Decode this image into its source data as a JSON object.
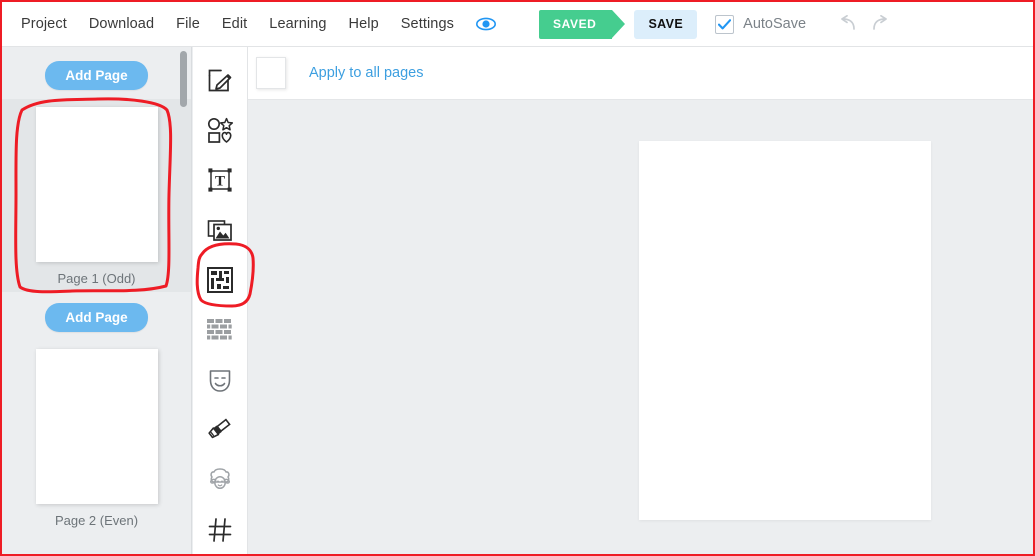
{
  "app": {
    "accent_blue": "#3d9fe0",
    "accent_green": "#45cd8f",
    "annotation_color": "#ee1c25",
    "button_blue": "#6cb9ef"
  },
  "topbar": {
    "menu": [
      {
        "label": "Project"
      },
      {
        "label": "Download"
      },
      {
        "label": "File"
      },
      {
        "label": "Edit"
      },
      {
        "label": "Learning"
      },
      {
        "label": "Help"
      },
      {
        "label": "Settings"
      }
    ],
    "preview_icon": "eye-icon",
    "saved_badge": "SAVED",
    "save_button": "SAVE",
    "autosave_label": "AutoSave",
    "autosave_checked": true,
    "undo_icon": "undo-arrow-icon",
    "redo_icon": "redo-arrow-icon"
  },
  "pages_panel": {
    "add_page_top": "Add Page",
    "add_page_middle": "Add Page",
    "pages": [
      {
        "caption": "Page 1 (Odd)",
        "selected": true
      },
      {
        "caption": "Page 2 (Even)",
        "selected": false
      }
    ]
  },
  "tool_rail": {
    "tools": [
      {
        "name": "edit-pencil-icon",
        "active": false
      },
      {
        "name": "shapes-icon",
        "active": false
      },
      {
        "name": "text-icon",
        "active": false
      },
      {
        "name": "image-icon",
        "active": false
      },
      {
        "name": "layout-template-icon",
        "active": true
      },
      {
        "name": "pattern-brick-icon",
        "active": false
      },
      {
        "name": "mask-theater-icon",
        "active": false
      },
      {
        "name": "paintbrush-icon",
        "active": false
      },
      {
        "name": "sheep-icon",
        "active": false
      },
      {
        "name": "grid-hash-icon",
        "active": false
      }
    ]
  },
  "canvas": {
    "apply_swatch": "page-swatch",
    "apply_link": "Apply to all pages"
  },
  "annotations": [
    {
      "name": "page-1-highlight",
      "target": "Page 1 (Odd)"
    },
    {
      "name": "layout-tool-highlight",
      "target": "layout-template-icon"
    }
  ]
}
